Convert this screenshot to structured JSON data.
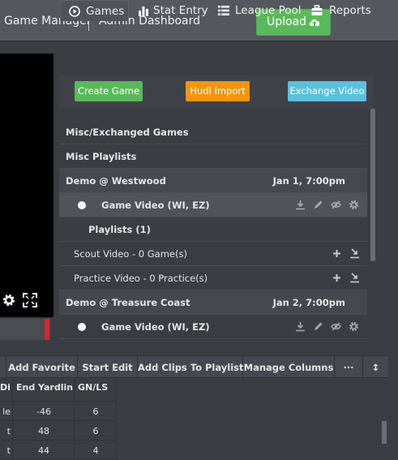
{
  "header": {
    "app_title": "Game Manager",
    "section_title": "Admin Dashboard",
    "upload_label": "Upload"
  },
  "tabs": [
    {
      "label": "Games",
      "icon": "play-circle-icon",
      "active": true
    },
    {
      "label": "Stat Entry",
      "icon": "bar-chart-icon",
      "active": false
    },
    {
      "label": "League Pool",
      "icon": "list-icon",
      "active": false
    },
    {
      "label": "Reports",
      "icon": "briefcase-icon",
      "active": false
    }
  ],
  "actions": {
    "create_game": "Create Game",
    "hudl_import": "Hudl Import",
    "exchange_video": "Exchange Video"
  },
  "game_list": {
    "misc_exchanged": "Misc/Exchanged Games",
    "misc_playlists": "Misc Playlists",
    "game1": {
      "title": "Demo @ Westwood",
      "date": "Jan 1, 7:00pm",
      "video": "Game Video (WI, EZ)"
    },
    "playlists_header": "Playlists (1)",
    "scout_video": "Scout Video - 0 Game(s)",
    "practice_video": "Practice Video - 0 Practice(s)",
    "game2": {
      "title": "Demo @ Treasure Coast",
      "date": "Jan 2, 7:00pm",
      "video": "Game Video (WI, EZ)"
    }
  },
  "toolbar": {
    "add_favorite": "Add Favorite",
    "start_edit": "Start Edit",
    "add_clips": "Add Clips To Playlist",
    "manage_columns": "Manage Columns",
    "more": "···",
    "sort": "↕"
  },
  "table": {
    "headers": [
      "Dir",
      "End Yardline",
      "GN/LS"
    ],
    "rows": [
      [
        "le",
        "-46",
        "6"
      ],
      [
        "t",
        "48",
        "6"
      ],
      [
        "t",
        "44",
        "4"
      ]
    ]
  },
  "colors": {
    "green": "#5cb85c",
    "orange": "#f0950f",
    "blue": "#5bc0de",
    "red": "#d9262c"
  }
}
